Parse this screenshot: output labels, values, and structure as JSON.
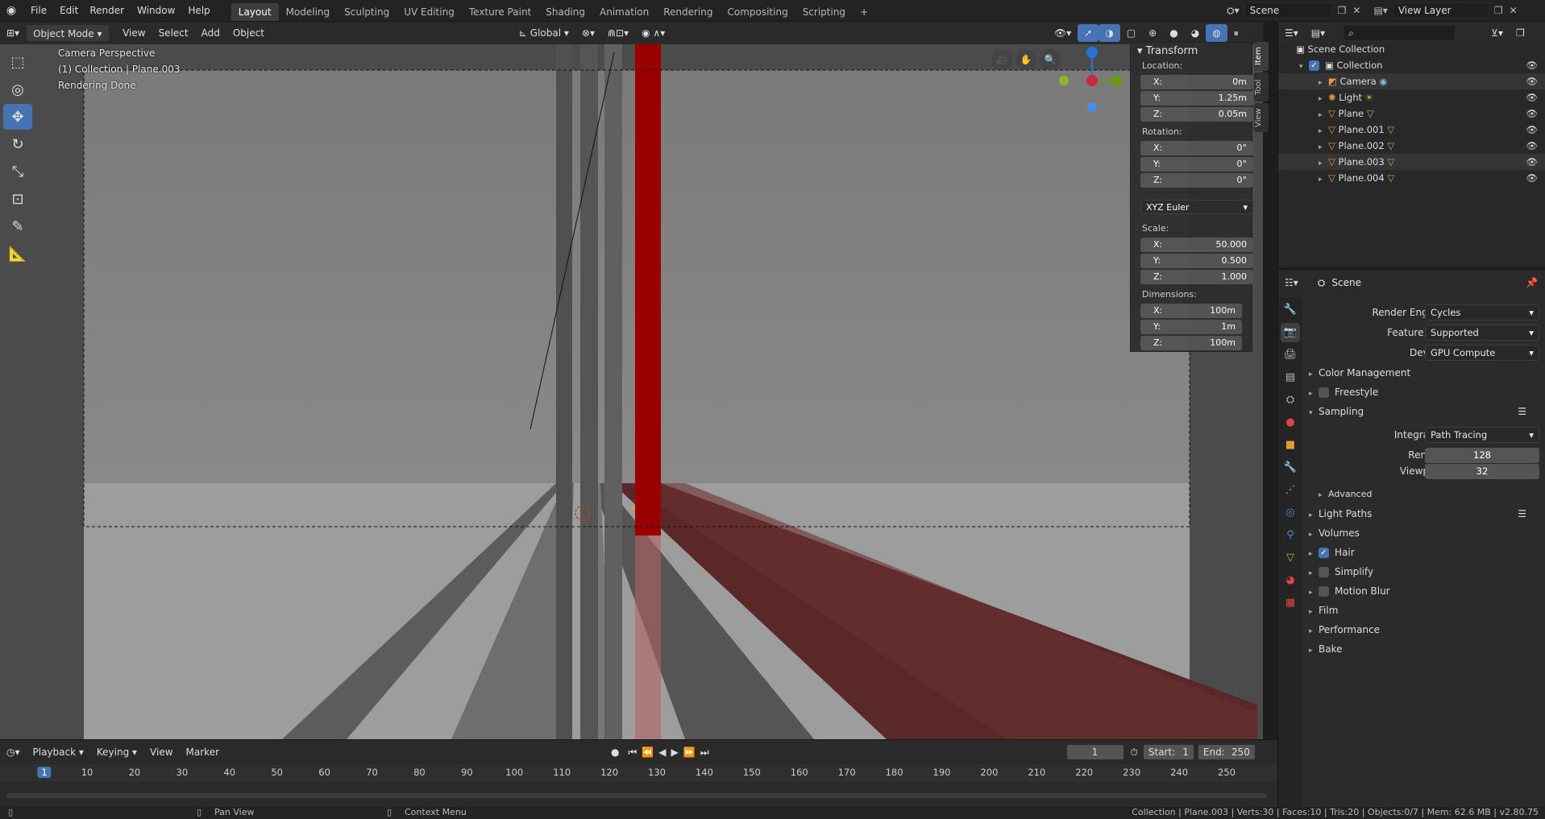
{
  "topbar": {
    "menus": [
      "File",
      "Edit",
      "Render",
      "Window",
      "Help"
    ],
    "workspaces": [
      "Layout",
      "Modeling",
      "Sculpting",
      "UV Editing",
      "Texture Paint",
      "Shading",
      "Animation",
      "Rendering",
      "Compositing",
      "Scripting"
    ],
    "add_tab": "+",
    "scene": "Scene",
    "view_layer": "View Layer"
  },
  "vpheader": {
    "mode": "Object Mode",
    "menus": [
      "View",
      "Select",
      "Add",
      "Object"
    ],
    "orientation": "Global"
  },
  "viewport": {
    "perspective": "Camera Perspective",
    "collection": "(1) Collection | Plane.003",
    "status": "Rendering Done"
  },
  "npanel": {
    "title": "Transform",
    "location_label": "Location:",
    "location": [
      {
        "axis": "X:",
        "value": "0m"
      },
      {
        "axis": "Y:",
        "value": "1.25m"
      },
      {
        "axis": "Z:",
        "value": "0.05m"
      }
    ],
    "rotation_label": "Rotation:",
    "rotation": [
      {
        "axis": "X:",
        "value": "0°"
      },
      {
        "axis": "Y:",
        "value": "0°"
      },
      {
        "axis": "Z:",
        "value": "0°"
      }
    ],
    "rotation_mode": "XYZ Euler",
    "scale_label": "Scale:",
    "scale": [
      {
        "axis": "X:",
        "value": "50.000"
      },
      {
        "axis": "Y:",
        "value": "0.500"
      },
      {
        "axis": "Z:",
        "value": "1.000"
      }
    ],
    "dimensions_label": "Dimensions:",
    "dimensions": [
      {
        "axis": "X:",
        "value": "100m"
      },
      {
        "axis": "Y:",
        "value": "1m"
      },
      {
        "axis": "Z:",
        "value": "100m"
      }
    ],
    "tabs": [
      "Item",
      "Tool",
      "View"
    ]
  },
  "outliner": {
    "root": "Scene Collection",
    "collection": "Collection",
    "items": [
      "Camera",
      "Light",
      "Plane",
      "Plane.001",
      "Plane.002",
      "Plane.003",
      "Plane.004"
    ]
  },
  "props": {
    "context": "Scene",
    "render_engine_label": "Render Engine",
    "render_engine": "Cycles",
    "feature_set_label": "Feature Set",
    "feature_set": "Supported",
    "device_label": "Device",
    "device": "GPU Compute",
    "panels": {
      "color_management": "Color Management",
      "freestyle": "Freestyle",
      "sampling": "Sampling",
      "integrator_label": "Integrator",
      "integrator": "Path Tracing",
      "render_label": "Render",
      "render": "128",
      "viewport_label": "Viewport",
      "viewport": "32",
      "advanced": "Advanced",
      "light_paths": "Light Paths",
      "volumes": "Volumes",
      "hair": "Hair",
      "simplify": "Simplify",
      "motion_blur": "Motion Blur",
      "film": "Film",
      "performance": "Performance",
      "bake": "Bake"
    }
  },
  "timeline": {
    "menus": [
      "Playback",
      "Keying",
      "View",
      "Marker"
    ],
    "current_frame": "1",
    "start_label": "Start:",
    "start": "1",
    "end_label": "End:",
    "end": "250",
    "ruler": [
      "1",
      "10",
      "20",
      "30",
      "40",
      "50",
      "60",
      "70",
      "80",
      "90",
      "100",
      "110",
      "120",
      "130",
      "140",
      "150",
      "160",
      "170",
      "180",
      "190",
      "200",
      "210",
      "220",
      "230",
      "240",
      "250"
    ]
  },
  "statusbar": {
    "pan": "Pan View",
    "context": "Context Menu",
    "stats": "Collection | Plane.003 | Verts:30 | Faces:10 | Tris:20 | Objects:0/7 | Mem: 62.6 MB | v2.80.75"
  }
}
